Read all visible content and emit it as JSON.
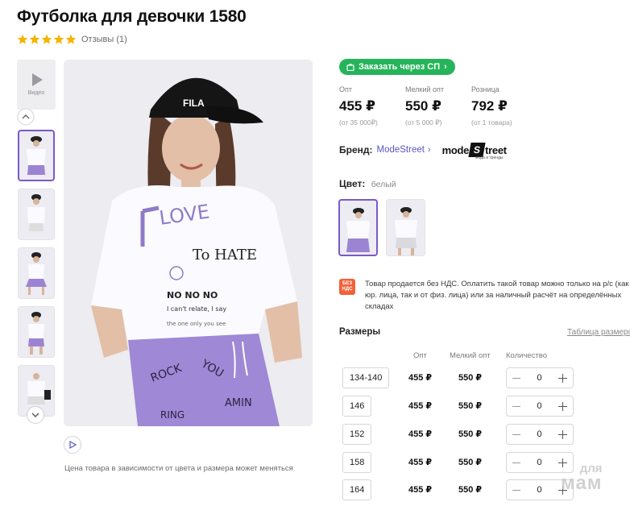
{
  "product": {
    "title": "Футболка для девочки 1580",
    "rating_stars": 5,
    "reviews_label": "Отзывы (1)"
  },
  "gallery": {
    "video_label": "Видео",
    "price_note": "Цена товара в зависимости от цвета и размера может меняться"
  },
  "order_button": {
    "label": "Заказать через СП",
    "chevron": "›"
  },
  "prices": [
    {
      "label": "Опт",
      "value": "455 ₽",
      "note": "(от 35 000₽)"
    },
    {
      "label": "Мелкий опт",
      "value": "550 ₽",
      "note": "(от 5 000 ₽)"
    },
    {
      "label": "Розница",
      "value": "792 ₽",
      "note": "(от 1 товара)"
    }
  ],
  "brand": {
    "label": "Бренд:",
    "name": "ModeStreet",
    "chevron": "›",
    "logo_left": "mode",
    "logo_s": "S",
    "logo_right": "treet",
    "logo_tagline": "мода и тренды"
  },
  "color": {
    "label": "Цвет:",
    "value": "белый"
  },
  "vat": {
    "badge_line1": "БЕЗ",
    "badge_line2": "НДС",
    "text": "Товар продается без НДС. Оплатить такой товар можно только на р/с (как от юр. лица, так и от физ. лица) или за наличный расчёт на определённых складах"
  },
  "sizes": {
    "title": "Размеры",
    "table_link": "Таблица размеров",
    "col_opt": "Опт",
    "col_small_opt": "Мелкий опт",
    "col_qty": "Количество",
    "rows": [
      {
        "size": "134-140",
        "opt": "455 ₽",
        "small_opt": "550 ₽",
        "qty": "0"
      },
      {
        "size": "146",
        "opt": "455 ₽",
        "small_opt": "550 ₽",
        "qty": "0"
      },
      {
        "size": "152",
        "opt": "455 ₽",
        "small_opt": "550 ₽",
        "qty": "0"
      },
      {
        "size": "158",
        "opt": "455 ₽",
        "small_opt": "550 ₽",
        "qty": "0"
      },
      {
        "size": "164",
        "opt": "455 ₽",
        "small_opt": "550 ₽",
        "qty": "0"
      }
    ]
  },
  "watermark": {
    "line1": "для",
    "line2": "мам"
  },
  "colors": {
    "accent_purple": "#7c59c9",
    "order_green": "#26b45a",
    "brand_link": "#5a55c7",
    "vat_badge": "#f0623a",
    "star": "#f5b400"
  }
}
